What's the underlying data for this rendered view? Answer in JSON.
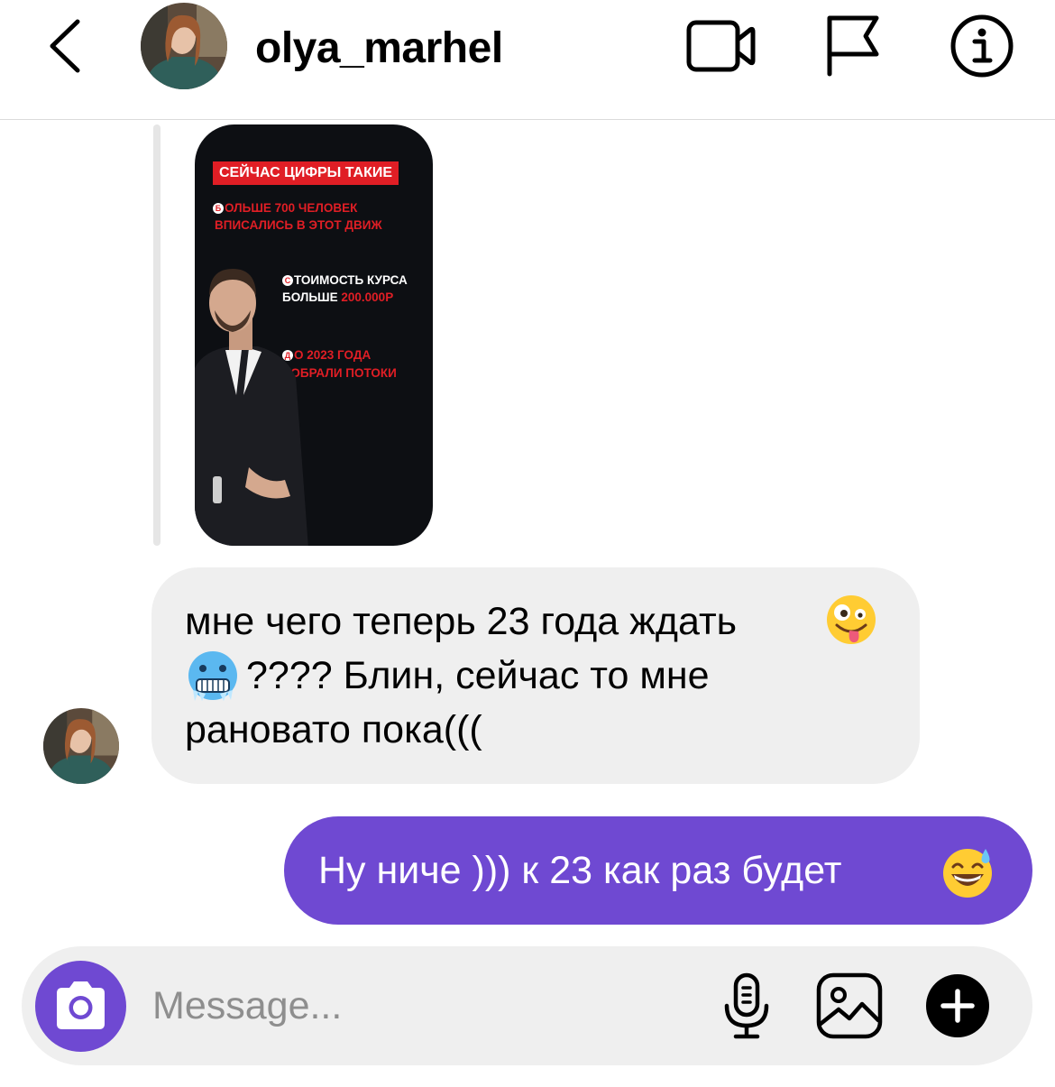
{
  "header": {
    "username": "olya_marhel",
    "icons": [
      "back-chevron-icon",
      "video-call-icon",
      "flag-icon",
      "info-icon"
    ]
  },
  "story": {
    "headline": "СЕЙЧАС ЦИФРЫ ТАКИЕ",
    "item1_initial": "Б",
    "item1_line1_rest": "ОЛЬШЕ 700 ЧЕЛОВЕК",
    "item1_line2": "ВПИСАЛИСЬ В ЭТОТ ДВИЖ",
    "item2_initial": "С",
    "item2_line1_rest": "ТОИМОСТЬ КУРСА",
    "item2_line2_prefix": "БОЛЬШЕ",
    "item2_line2_price": "200.000Р",
    "item3_initial": "Д",
    "item3_line1_rest": "О 2023 ГОДА",
    "item3_line2": "СОБРАЛИ ПОТОКИ"
  },
  "messages": {
    "incoming": {
      "line1": "мне чего теперь 23 года ждать",
      "line2": "???? Блин, сейчас то мне",
      "line3": "рановато пока(((",
      "emojis": [
        "zany-face",
        "cold-face"
      ]
    },
    "outgoing": {
      "text": "Ну ниче ))) к 23 как раз будет",
      "emojis": [
        "grinning-face-with-sweat"
      ]
    }
  },
  "composer": {
    "placeholder": "Message...",
    "icons": [
      "camera-icon",
      "microphone-icon",
      "gallery-icon",
      "plus-icon"
    ]
  },
  "colors": {
    "accent": "#6f49d2",
    "incoming_bubble": "#efefef",
    "story_red": "#e01e25",
    "divider": "#dbdbdb"
  }
}
